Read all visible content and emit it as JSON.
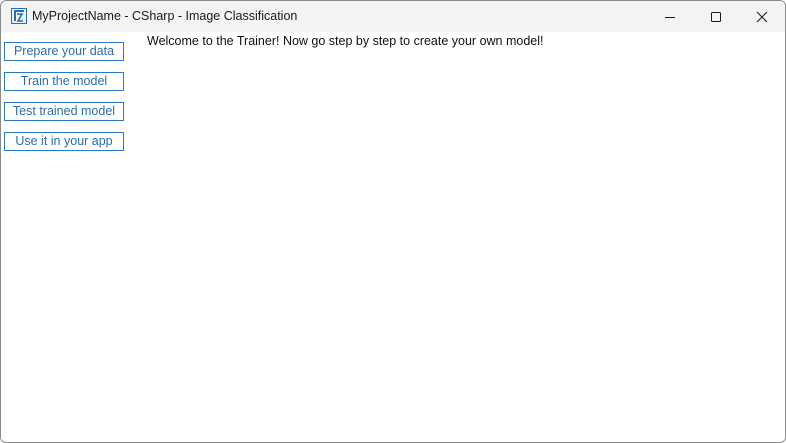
{
  "window": {
    "title": "MyProjectName - CSharp - Image Classification",
    "icon": "app-logo-icon",
    "controls": {
      "minimize_icon": "minimize-icon",
      "maximize_icon": "maximize-icon",
      "close_icon": "close-icon"
    }
  },
  "sidebar": {
    "items": [
      {
        "label": "Prepare your data"
      },
      {
        "label": "Train the model"
      },
      {
        "label": "Test trained model"
      },
      {
        "label": "Use it in your app"
      }
    ]
  },
  "main": {
    "welcome_text": "Welcome to the Trainer! Now go step by step to create your own model!"
  },
  "colors": {
    "accent": "#2b78c6",
    "titlebar": "#f3f3f3",
    "background": "#ffffff"
  }
}
